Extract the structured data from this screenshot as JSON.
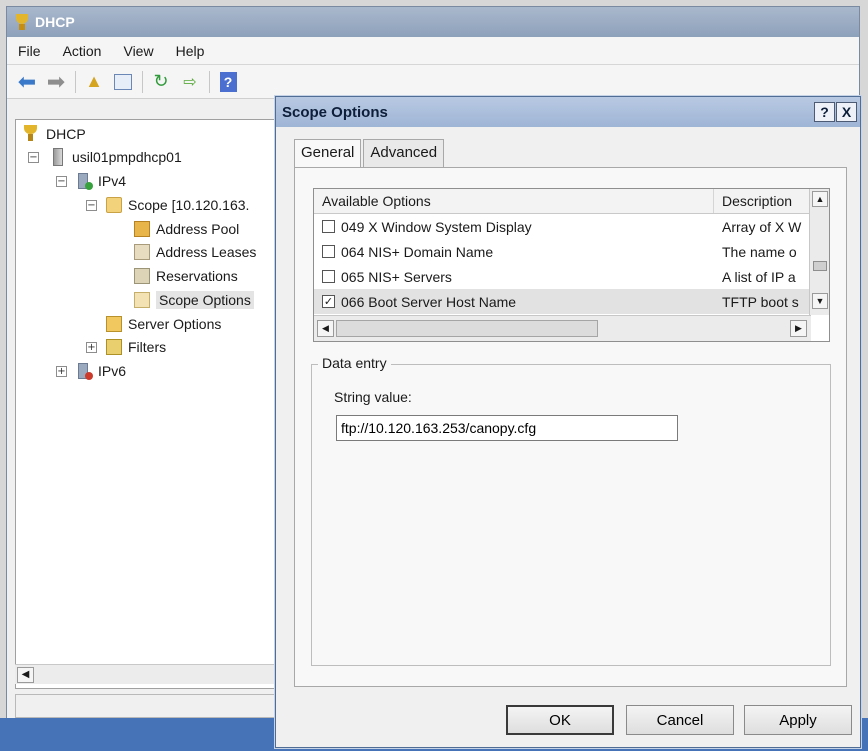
{
  "main_window": {
    "title": "DHCP",
    "menu": [
      "File",
      "Action",
      "View",
      "Help"
    ]
  },
  "tree": {
    "root": "DHCP",
    "server": "usil01pmpdhcp01",
    "ipv4": "IPv4",
    "scope": "Scope [10.120.163.",
    "scope_children": [
      "Address Pool",
      "Address Leases",
      "Reservations",
      "Scope Options"
    ],
    "server_options": "Server Options",
    "filters": "Filters",
    "ipv6": "IPv6",
    "selected": "Scope Options"
  },
  "dialog": {
    "title": "Scope Options",
    "help_glyph": "?",
    "close_glyph": "X",
    "tabs": [
      "General",
      "Advanced"
    ],
    "active_tab": "General",
    "list": {
      "columns": [
        "Available Options",
        "Description"
      ],
      "rows": [
        {
          "checked": false,
          "name": "049 X Window System Display",
          "desc": "Array of X W"
        },
        {
          "checked": false,
          "name": "064 NIS+ Domain Name",
          "desc": "The name o"
        },
        {
          "checked": false,
          "name": "065 NIS+ Servers",
          "desc": "A list of IP a"
        },
        {
          "checked": true,
          "name": "066 Boot Server Host Name",
          "desc": "TFTP boot s"
        }
      ]
    },
    "data_entry": {
      "group_label": "Data entry",
      "field_label": "String value:",
      "value": "ftp://10.120.163.253/canopy.cfg"
    },
    "buttons": {
      "ok": "OK",
      "cancel": "Cancel",
      "apply": "Apply"
    }
  }
}
